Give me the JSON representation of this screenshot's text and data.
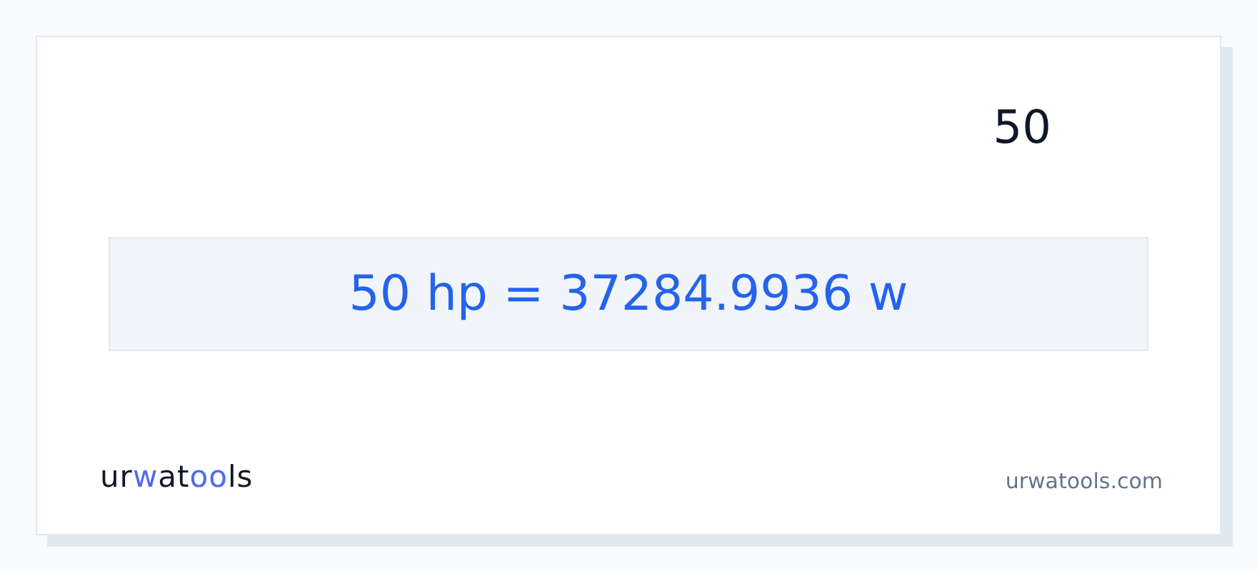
{
  "input_value": "50",
  "result": "50 hp = 37284.9936 w",
  "logo": [
    {
      "text": "ur",
      "accent": false
    },
    {
      "text": "w",
      "accent": true
    },
    {
      "text": "at",
      "accent": false
    },
    {
      "text": "oo",
      "accent": true
    },
    {
      "text": "ls",
      "accent": false
    }
  ],
  "site": "urwatools.com"
}
